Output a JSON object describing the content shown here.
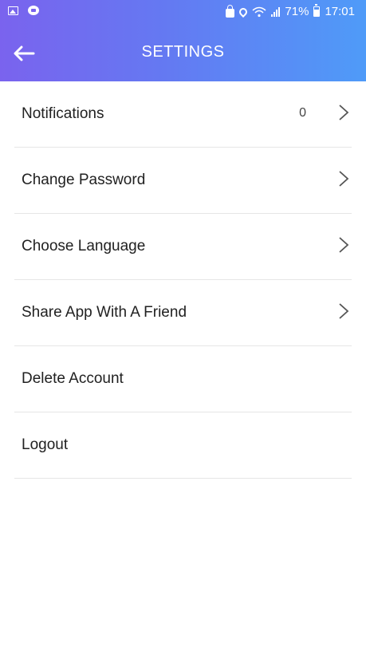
{
  "status_bar": {
    "battery_percent": "71%",
    "time": "17:01",
    "left_icons": [
      "gallery-icon",
      "chat-icon"
    ],
    "right_icons": [
      "lock-icon",
      "location-pin-icon",
      "wifi-icon",
      "signal-icon",
      "battery-icon"
    ]
  },
  "header": {
    "title": "SETTINGS",
    "back_icon": "arrow-left-icon",
    "gradient_start": "#7a63ee",
    "gradient_end": "#4f9bf8"
  },
  "menu": {
    "items": [
      {
        "label": "Notifications",
        "count": "0",
        "chevron": true
      },
      {
        "label": "Change Password",
        "chevron": true
      },
      {
        "label": "Choose Language",
        "chevron": true
      },
      {
        "label": "Share App With A Friend",
        "chevron": true
      },
      {
        "label": "Delete Account",
        "chevron": false
      },
      {
        "label": "Logout",
        "chevron": false
      }
    ]
  }
}
